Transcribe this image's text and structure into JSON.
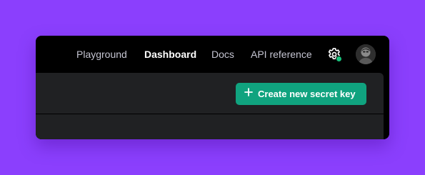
{
  "nav": {
    "items": [
      {
        "label": "Playground",
        "active": false
      },
      {
        "label": "Dashboard",
        "active": true
      },
      {
        "label": "Docs",
        "active": false
      },
      {
        "label": "API reference",
        "active": false
      }
    ],
    "settings_icon": "gear-icon",
    "settings_status_color": "#19c37d",
    "avatar_icon": "user-avatar"
  },
  "panel": {
    "create_button_label": "Create new secret key",
    "create_button_icon": "plus-icon",
    "create_button_color": "#10a37f"
  },
  "colors": {
    "background": "#8b3ffd",
    "window": "#000000",
    "panel": "#202123",
    "nav_text": "#c5c5d2",
    "nav_active_text": "#ffffff"
  }
}
